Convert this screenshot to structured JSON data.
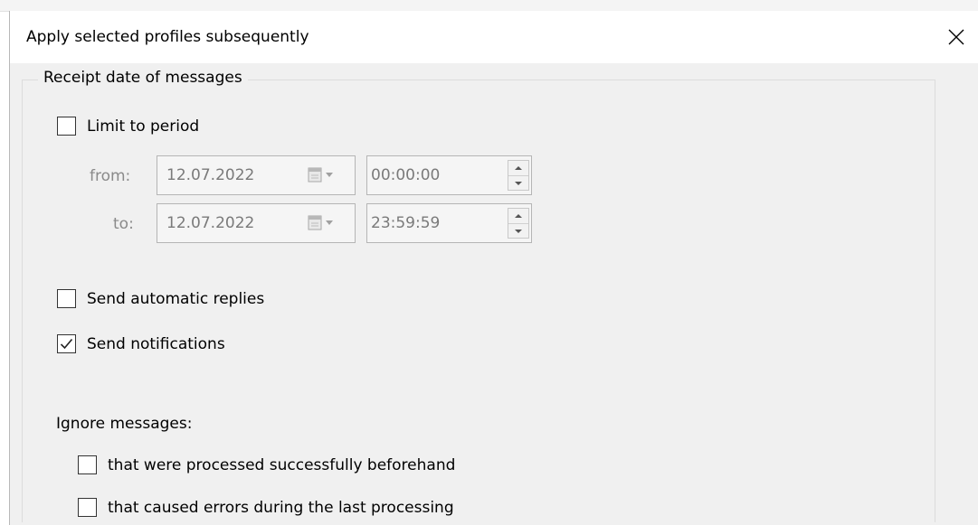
{
  "dialog": {
    "title": "Apply selected profiles subsequently",
    "close_glyph": "✕"
  },
  "receipt": {
    "legend": "Receipt date of messages",
    "limit_label": "Limit to period",
    "limit_checked": false,
    "from_label": "from:",
    "to_label": "to:",
    "from_date": "12.07.2022",
    "from_time": "00:00:00",
    "to_date": "12.07.2022",
    "to_time": "23:59:59",
    "enabled": false
  },
  "options": {
    "auto_replies_label": "Send automatic replies",
    "auto_replies_checked": false,
    "notifications_label": "Send notifications",
    "notifications_checked": true
  },
  "ignore": {
    "heading": "Ignore messages:",
    "processed_label": "that were processed successfully beforehand",
    "processed_checked": false,
    "errors_label": "that caused errors during the last processing",
    "errors_checked": false
  },
  "icons": {
    "calendar": "calendar-dropdown-icon",
    "spinner": "spin-updown-icon",
    "check": "checkmark-icon",
    "close": "close-icon"
  }
}
